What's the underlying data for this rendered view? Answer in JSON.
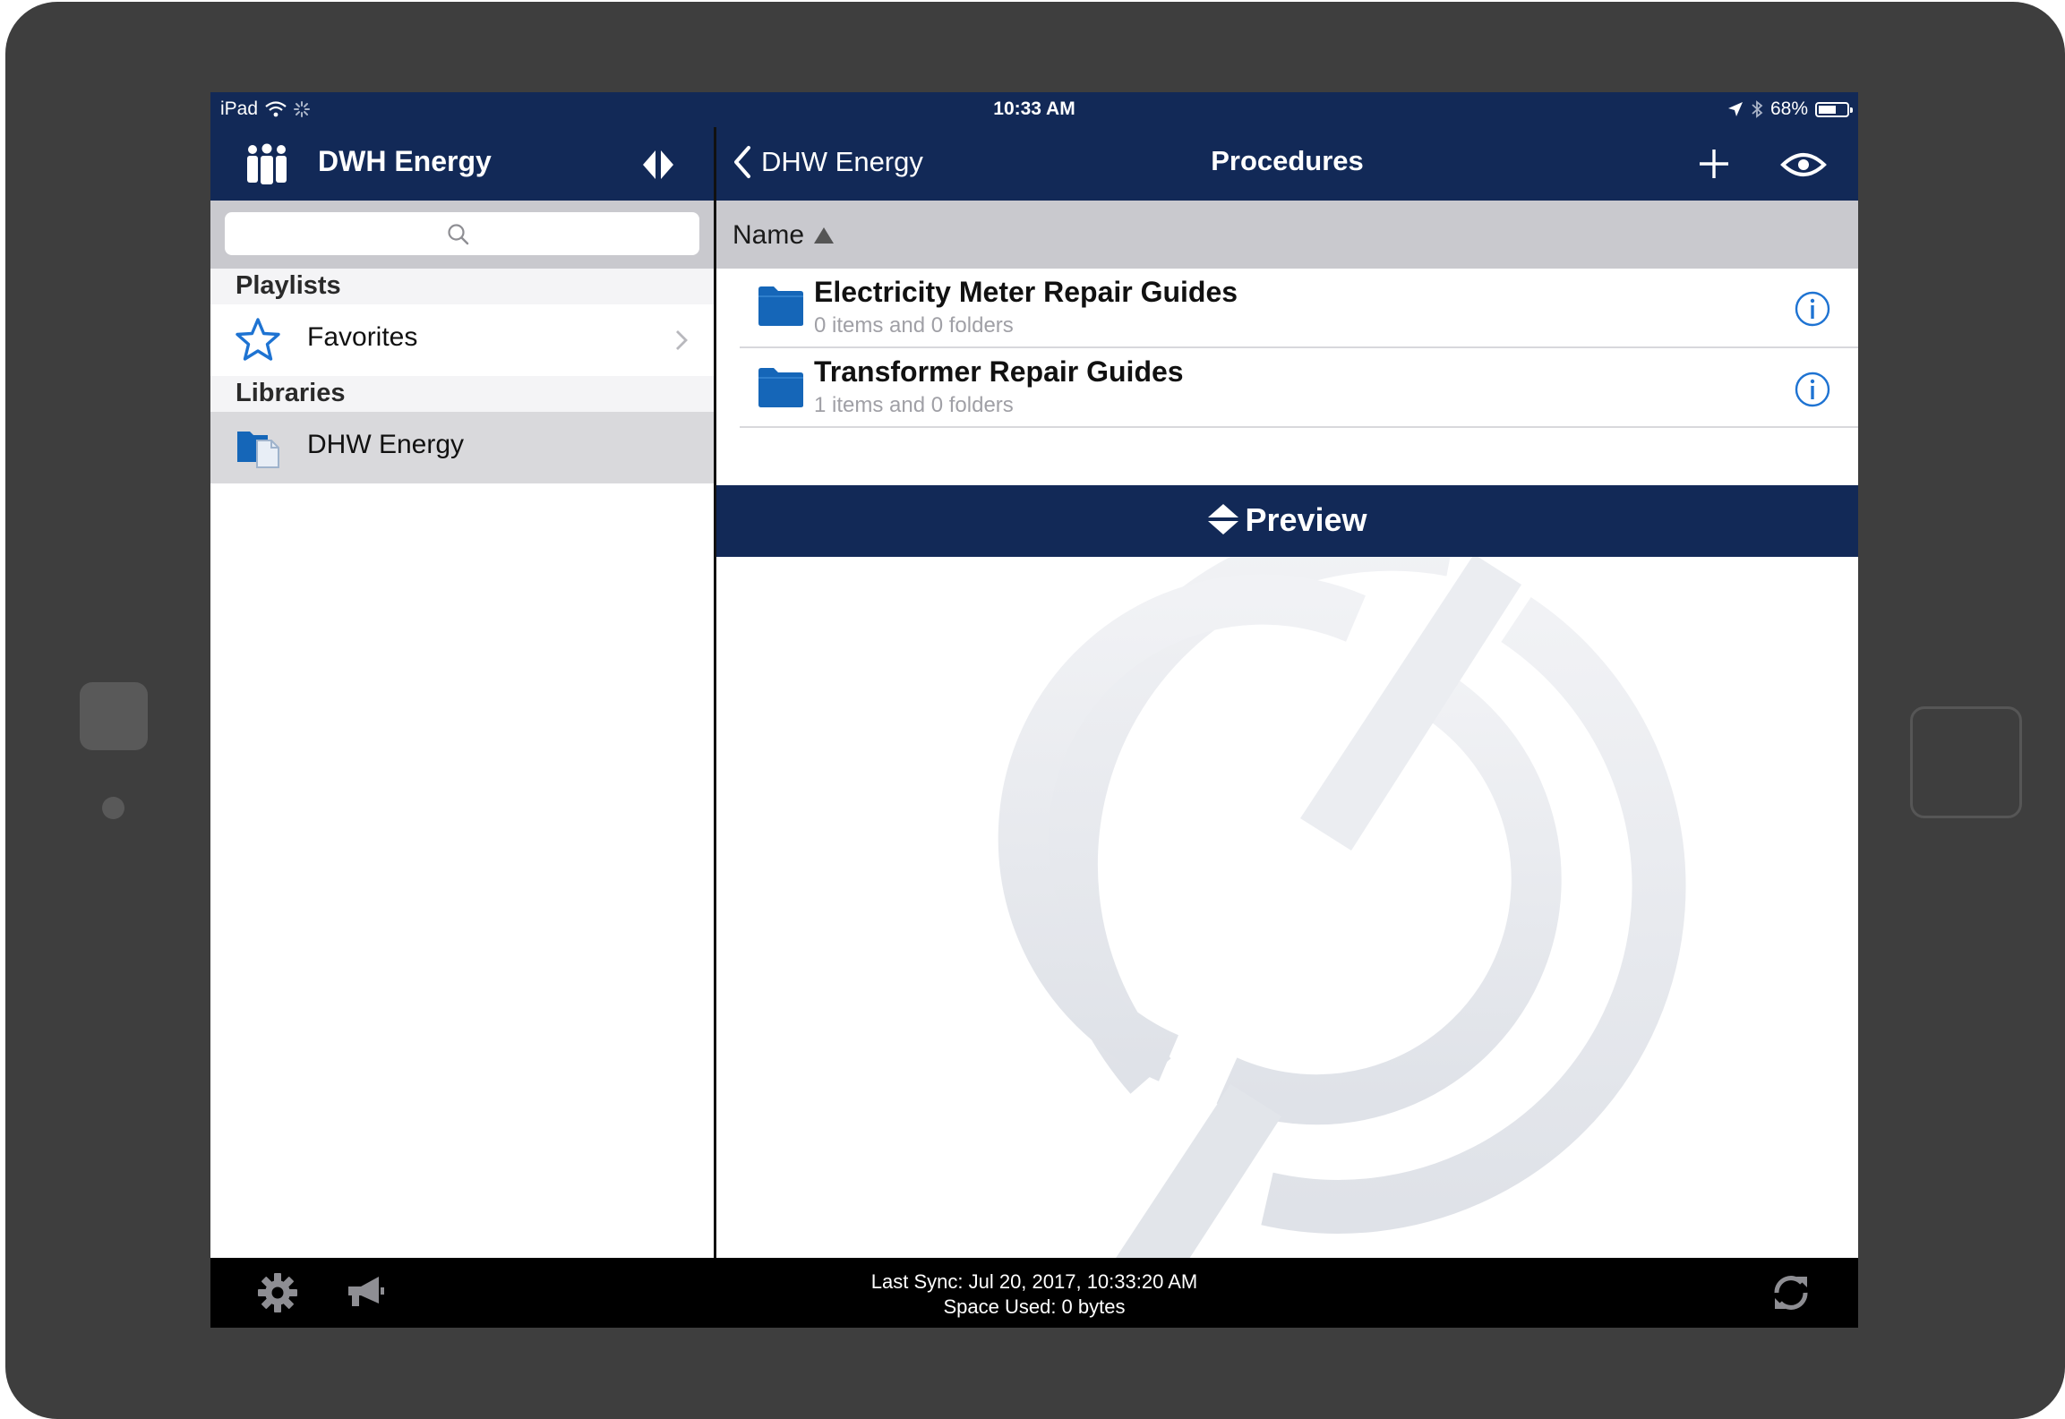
{
  "status_bar": {
    "device": "iPad",
    "time": "10:33 AM",
    "battery": "68%",
    "battery_level": 0.68
  },
  "sidebar": {
    "title": "DWH Energy",
    "search_placeholder": "",
    "playlists_header": "Playlists",
    "favorites_label": "Favorites",
    "libraries_header": "Libraries",
    "library_label": "DHW Energy"
  },
  "main": {
    "back_label": "DHW Energy",
    "title": "Procedures",
    "column_name": "Name",
    "items": [
      {
        "title": "Electricity Meter Repair Guides",
        "subtitle": "0 items and 0 folders"
      },
      {
        "title": "Transformer Repair Guides",
        "subtitle": "1 items and 0 folders"
      }
    ],
    "preview_label": "Preview"
  },
  "bottom_bar": {
    "last_sync": "Last Sync: Jul 20, 2017, 10:33:20 AM",
    "space_used": "Space Used: 0 bytes"
  },
  "colors": {
    "navy": "#122957",
    "accent_blue": "#1e73d2",
    "folder_blue": "#1566b8",
    "gray_header": "#c9c9ce"
  },
  "icons": [
    "wifi-icon",
    "activity-icon",
    "location-icon",
    "bluetooth-icon",
    "battery-icon",
    "group-icon",
    "split-view-icon",
    "search-icon",
    "star-icon",
    "chevron-right-icon",
    "library-icon",
    "back-chevron-icon",
    "plus-icon",
    "eye-icon",
    "sort-up-icon",
    "folder-icon",
    "info-icon",
    "preview-toggle-icon",
    "gear-icon",
    "megaphone-icon",
    "sync-icon"
  ]
}
